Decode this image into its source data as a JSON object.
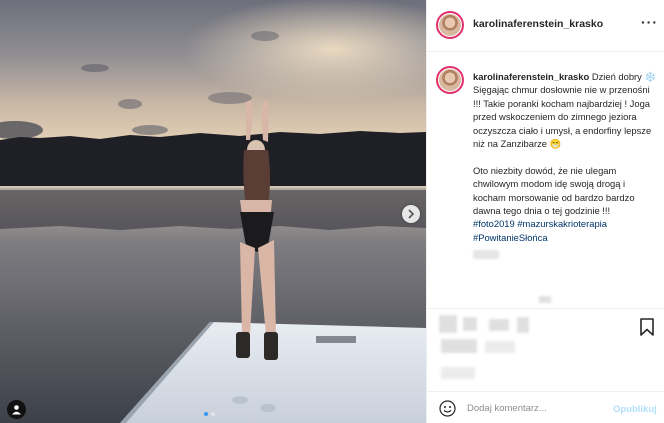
{
  "post": {
    "username": "karolinaferenstein_krasko",
    "more_label": "···",
    "caption_p1": "Dzień dobry ❄️ Sięgając chmur dosłownie nie w przenośni !!! Takie poranki kocham najbardziej ! Joga przed wskoczeniem do zimnego jeziora oczyszcza ciało i umysł, a endorfiny lepsze niż na Zanzibarze 😁",
    "caption_p2": "Oto niezbity dowód, że nie ulegam chwilowym modom idę swoją drogą i kocham morsowanie od bardzo bardzo dawna tego dnia o tej godzinie !!!",
    "hashtags": [
      "#foto2019",
      "#mazurskakrioterapia",
      "#PowitanieSłońca"
    ]
  },
  "comment_bar": {
    "placeholder": "Dodaj komentarz...",
    "publish_label": "Opublikuj"
  },
  "carousel": {
    "total_images": 2,
    "current_index": 1
  },
  "colors": {
    "accent": "#3897f0",
    "hashtag": "#003569",
    "story_ring": "#e1306c",
    "publish_disabled": "#b2dffc"
  },
  "icons": [
    "chevron-right-icon",
    "user-tag-icon",
    "bookmark-icon",
    "emoji-icon",
    "more-icon"
  ]
}
